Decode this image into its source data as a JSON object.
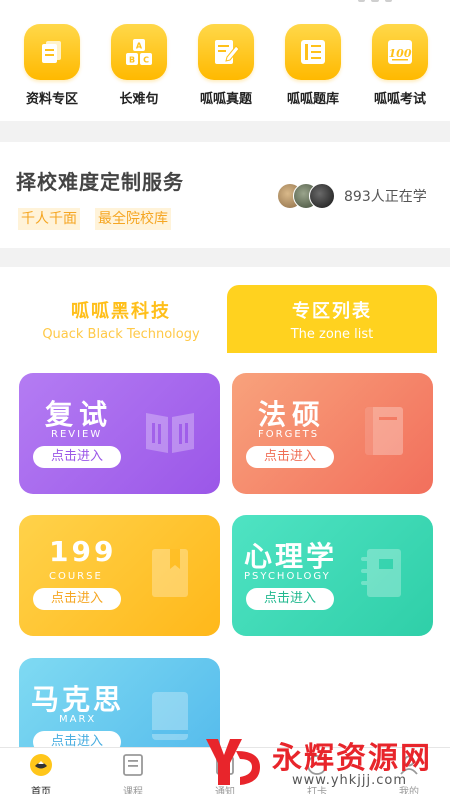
{
  "quick_links": [
    {
      "label": "资料专区",
      "icon": "document-stack-icon"
    },
    {
      "label": "长难句",
      "icon": "abc-blocks-icon"
    },
    {
      "label": "呱呱真题",
      "icon": "exam-paper-pen-icon"
    },
    {
      "label": "呱呱题库",
      "icon": "question-bank-icon"
    },
    {
      "label": "呱呱考试",
      "icon": "score-100-icon"
    }
  ],
  "service": {
    "title": "择校难度定制服务",
    "tags": [
      "千人千面",
      "最全院校库"
    ],
    "learners_text": "893人正在学"
  },
  "tabs": [
    {
      "cn": "呱呱黑科技",
      "en": "Quack Black Technology",
      "active": false
    },
    {
      "cn": "专区列表",
      "en": "The zone list",
      "active": true
    }
  ],
  "zones": [
    {
      "cn": "复试",
      "en": "REVIEW",
      "button": "点击进入",
      "icon": "open-book-icon"
    },
    {
      "cn": "法硕",
      "en": "FORGETS",
      "button": "点击进入",
      "icon": "law-book-icon"
    },
    {
      "cn": "199",
      "en": "COURSE",
      "button": "点击进入",
      "icon": "bookmark-book-icon"
    },
    {
      "cn": "心理学",
      "en": "PSYCHOLOGY",
      "button": "点击进入",
      "icon": "notebook-icon"
    },
    {
      "cn": "马克思",
      "en": "MARX",
      "button": "点击进入",
      "icon": "closed-book-icon"
    }
  ],
  "nav": [
    {
      "label": "首页",
      "icon": "home-duck-icon",
      "active": true
    },
    {
      "label": "课程",
      "icon": "course-icon",
      "active": false
    },
    {
      "label": "通知",
      "icon": "notification-icon",
      "active": false
    },
    {
      "label": "打卡",
      "icon": "checkin-icon",
      "active": false
    },
    {
      "label": "我的",
      "icon": "profile-icon",
      "active": false
    }
  ],
  "watermark": {
    "name": "永辉资源网",
    "url": "www.yhkjjj.com"
  },
  "colors": {
    "accent": "#ffc61a",
    "brand_tab": "#ffd21f",
    "watermark_red": "#e8252b"
  }
}
